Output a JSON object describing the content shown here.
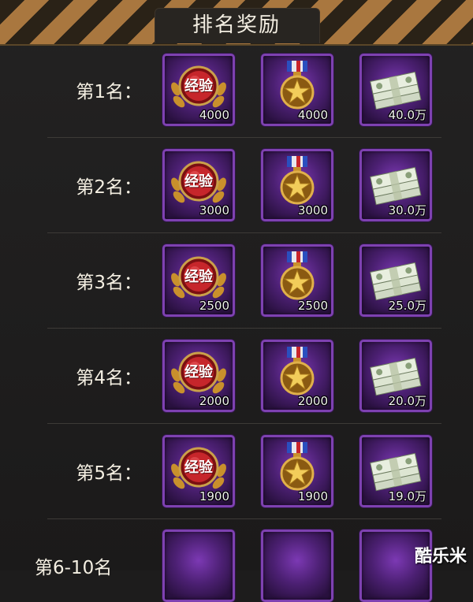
{
  "header": {
    "title": "排名奖励"
  },
  "rows": [
    {
      "rank": "第1名：",
      "exp_label": "经验",
      "exp": "4000",
      "medal": "4000",
      "money": "40.0万"
    },
    {
      "rank": "第2名：",
      "exp_label": "经验",
      "exp": "3000",
      "medal": "3000",
      "money": "30.0万"
    },
    {
      "rank": "第3名：",
      "exp_label": "经验",
      "exp": "2500",
      "medal": "2500",
      "money": "25.0万"
    },
    {
      "rank": "第4名：",
      "exp_label": "经验",
      "exp": "2000",
      "medal": "2000",
      "money": "20.0万"
    },
    {
      "rank": "第5名：",
      "exp_label": "经验",
      "exp": "1900",
      "medal": "1900",
      "money": "19.0万"
    }
  ],
  "partial_row": {
    "rank": "第6-10名"
  },
  "watermark": "酷乐米",
  "icons": {
    "exp": "exp-badge-icon",
    "medal": "star-medal-icon",
    "money": "cash-stack-icon"
  },
  "colors": {
    "slot_border": "#7e41b1",
    "slot_fill": "#4c2073",
    "stripe": "#a9773f"
  }
}
